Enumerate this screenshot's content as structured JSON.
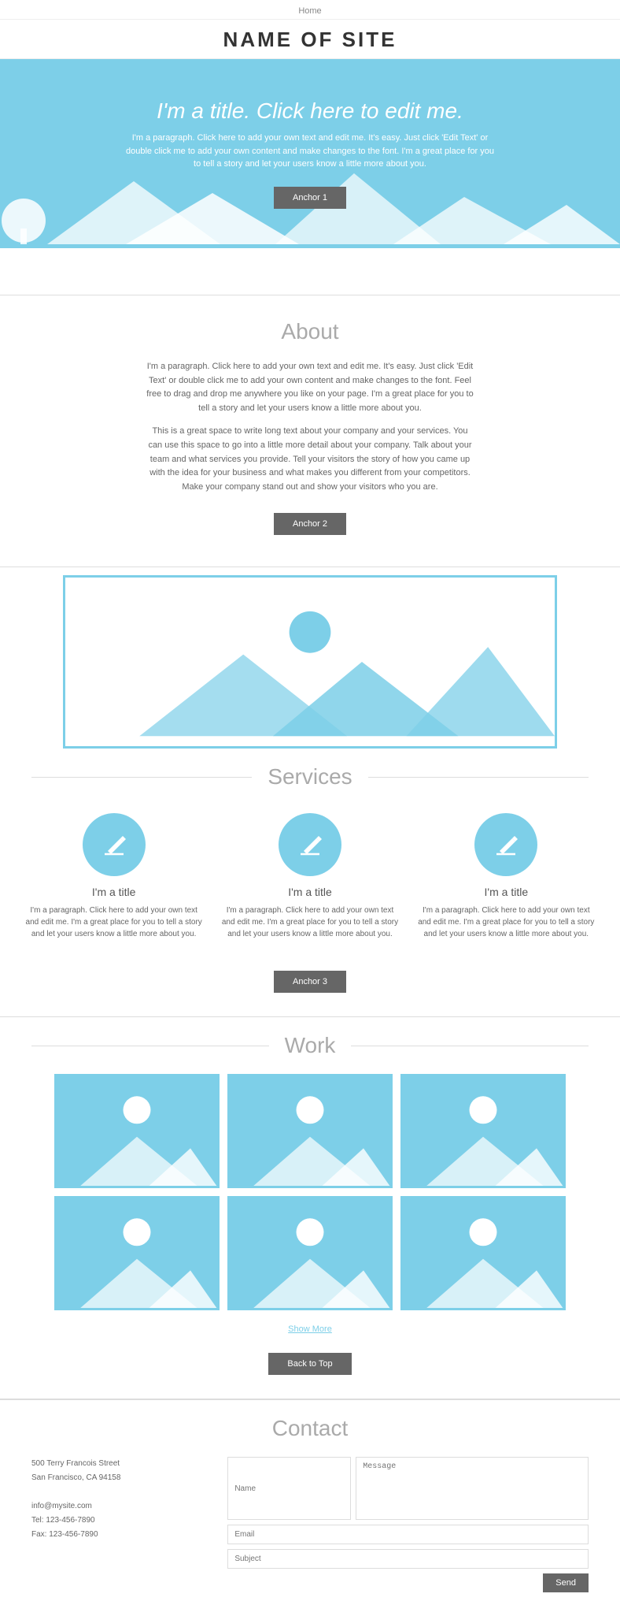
{
  "nav": {
    "home_label": "Home"
  },
  "header": {
    "site_title": "NAME OF SITE"
  },
  "hero": {
    "title": "I'm a title. Click here to edit me.",
    "paragraph": "I'm a paragraph. Click here to add your own text and edit me. It's easy. Just click 'Edit Text' or double click me to add your own content and make changes to the font. I'm a great place for you to tell a story and let your users know a little more about you.",
    "anchor_label": "Anchor 1"
  },
  "about": {
    "section_title": "About",
    "paragraph1": "I'm a paragraph. Click here to add your own text and edit me. It's easy. Just click 'Edit Text' or double click me to add your own content and make changes to the font. Feel free to drag and drop me anywhere you like on your page. I'm a great place for you to tell a story and let your users know a little more about you.",
    "paragraph2": "This is a great space to write long text about your company and your services. You can use this space to go into a little more detail about your company. Talk about your team and what services you provide. Tell your visitors the story of how you came up with the idea for your business and what makes you different from your competitors. Make your company stand out and show your visitors who you are.",
    "anchor_label": "Anchor 2"
  },
  "services": {
    "section_title": "Services",
    "items": [
      {
        "title": "I'm a title",
        "paragraph": "I'm a paragraph. Click here to add your own text and edit me. I'm a great place for you to tell a story and let your users know a little more about you."
      },
      {
        "title": "I'm a title",
        "paragraph": "I'm a paragraph. Click here to add your own text and edit me. I'm a great place for you to tell a story and let your users know a little more about you."
      },
      {
        "title": "I'm a title",
        "paragraph": "I'm a paragraph. Click here to add your own text and edit me. I'm a great place for you to tell a story and let your users know a little more about you."
      }
    ],
    "anchor_label": "Anchor 3"
  },
  "work": {
    "section_title": "Work",
    "show_more_label": "Show More",
    "back_to_top_label": "Back to Top"
  },
  "contact": {
    "section_title": "Contact",
    "address_line1": "500 Terry Francois Street",
    "address_line2": "San Francisco, CA 94158",
    "email": "info@mysite.com",
    "tel": "Tel: 123-456-7890",
    "fax": "Fax: 123-456-7890",
    "form": {
      "name_placeholder": "Name",
      "email_placeholder": "Email",
      "subject_placeholder": "Subject",
      "message_placeholder": "Message",
      "submit_label": "Send"
    }
  },
  "colors": {
    "accent": "#7dcfe8",
    "button_bg": "#666666",
    "text_gray": "#555555"
  }
}
